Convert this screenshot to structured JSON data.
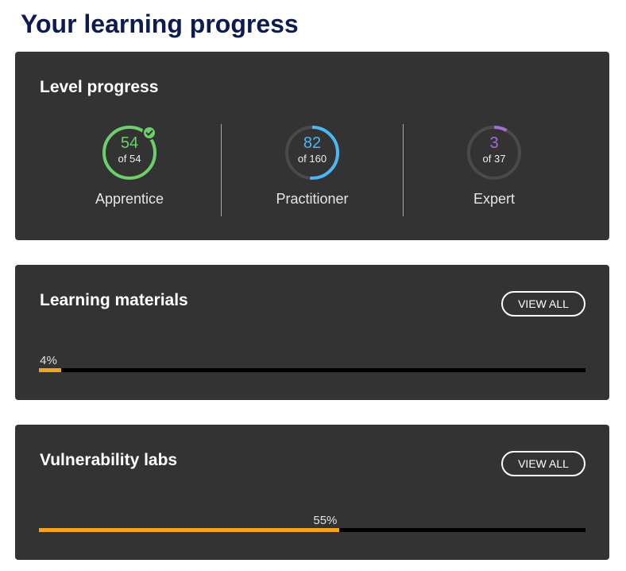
{
  "page": {
    "title": "Your learning progress"
  },
  "level_progress": {
    "title": "Level progress",
    "levels": [
      {
        "name": "Apprentice",
        "count": "54",
        "total": "of 54",
        "fraction": 1.0,
        "color": "#6ccf6c",
        "completed": true,
        "badge_icon": "check-icon"
      },
      {
        "name": "Practitioner",
        "count": "82",
        "total": "of 160",
        "fraction": 0.5125,
        "color": "#49b8f5",
        "completed": false
      },
      {
        "name": "Expert",
        "count": "3",
        "total": "of 37",
        "fraction": 0.081,
        "color": "#a66bd6",
        "completed": false
      }
    ],
    "ring_track_color": "#4a4a4a"
  },
  "learning_materials": {
    "title": "Learning materials",
    "view_all_label": "VIEW ALL",
    "percent_label": "4%",
    "fraction": 0.04
  },
  "vulnerability_labs": {
    "title": "Vulnerability labs",
    "view_all_label": "VIEW ALL",
    "percent_label": "55%",
    "fraction": 0.55
  },
  "colors": {
    "title": "#0d1b4f",
    "card_background": "#333333",
    "progress_fill": "#f5a31a",
    "progress_track": "#000000"
  }
}
